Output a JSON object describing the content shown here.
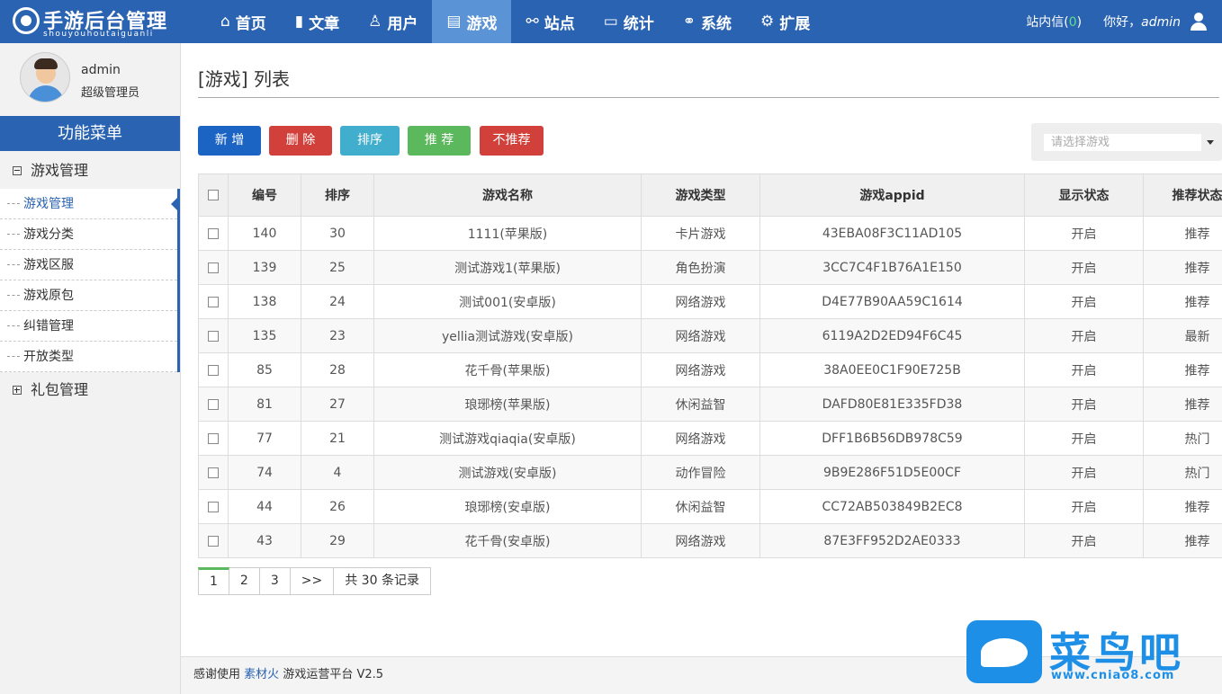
{
  "header": {
    "logo_title": "手游后台管理",
    "logo_sub": "shouyouhoutaiguanli",
    "nav": [
      {
        "label": "首页",
        "icon": "⌂"
      },
      {
        "label": "文章",
        "icon": "▮"
      },
      {
        "label": "用户",
        "icon": "♙"
      },
      {
        "label": "游戏",
        "icon": "▤"
      },
      {
        "label": "站点",
        "icon": "⚯"
      },
      {
        "label": "统计",
        "icon": "▭"
      },
      {
        "label": "系统",
        "icon": "⚭"
      },
      {
        "label": "扩展",
        "icon": "⚙"
      }
    ],
    "message_label": "站内信",
    "message_open": "(",
    "message_count": "0",
    "message_close": ")",
    "hello_prefix": "你好，",
    "username": "admin"
  },
  "sidebar": {
    "profile_name": "admin",
    "profile_role": "超级管理员",
    "menu_title": "功能菜单",
    "groups": [
      "游戏管理",
      "礼包管理"
    ],
    "items": [
      "游戏管理",
      "游戏分类",
      "游戏区服",
      "游戏原包",
      "纠错管理",
      "开放类型"
    ]
  },
  "main": {
    "page_title": "[游戏] 列表",
    "buttons": {
      "add": "新 增",
      "delete": "删 除",
      "sort": "排序",
      "recommend": "推 荐",
      "unrecommend": "不推荐"
    },
    "select_placeholder": "请选择游戏",
    "table": {
      "headers": [
        "编号",
        "排序",
        "游戏名称",
        "游戏类型",
        "游戏appid",
        "显示状态",
        "推荐状态"
      ],
      "rows": [
        [
          "140",
          "30",
          "1111(苹果版)",
          "卡片游戏",
          "43EBA08F3C11AD105",
          "开启",
          "推荐"
        ],
        [
          "139",
          "25",
          "测试游戏1(苹果版)",
          "角色扮演",
          "3CC7C4F1B76A1E150",
          "开启",
          "推荐"
        ],
        [
          "138",
          "24",
          "测试001(安卓版)",
          "网络游戏",
          "D4E77B90AA59C1614",
          "开启",
          "推荐"
        ],
        [
          "135",
          "23",
          "yellia测试游戏(安卓版)",
          "网络游戏",
          "6119A2D2ED94F6C45",
          "开启",
          "最新"
        ],
        [
          "85",
          "28",
          "花千骨(苹果版)",
          "网络游戏",
          "38A0EE0C1F90E725B",
          "开启",
          "推荐"
        ],
        [
          "81",
          "27",
          "琅琊榜(苹果版)",
          "休闲益智",
          "DAFD80E81E335FD38",
          "开启",
          "推荐"
        ],
        [
          "77",
          "21",
          "测试游戏qiaqia(安卓版)",
          "网络游戏",
          "DFF1B6B56DB978C59",
          "开启",
          "热门"
        ],
        [
          "74",
          "4",
          "测试游戏(安卓版)",
          "动作冒险",
          "9B9E286F51D5E00CF",
          "开启",
          "热门"
        ],
        [
          "44",
          "26",
          "琅琊榜(安卓版)",
          "休闲益智",
          "CC72AB503849B2EC8",
          "开启",
          "推荐"
        ],
        [
          "43",
          "29",
          "花千骨(安卓版)",
          "网络游戏",
          "87E3FF952D2AE0333",
          "开启",
          "推荐"
        ]
      ]
    },
    "pagination": {
      "pages": [
        "1",
        "2",
        "3"
      ],
      "next": ">>",
      "total": "共 30 条记录"
    }
  },
  "footer": {
    "prefix": "感谢使用",
    "link": "素材火",
    "suffix": "游戏运营平台 V2.5"
  },
  "watermark": {
    "text": "菜鸟吧",
    "url": "www.cniao8.com"
  },
  "colors": {
    "brand": "#2a63b1",
    "nav_active": "#5b94d6",
    "danger": "#d1403a",
    "success": "#5cb85c",
    "info": "#42aece"
  }
}
